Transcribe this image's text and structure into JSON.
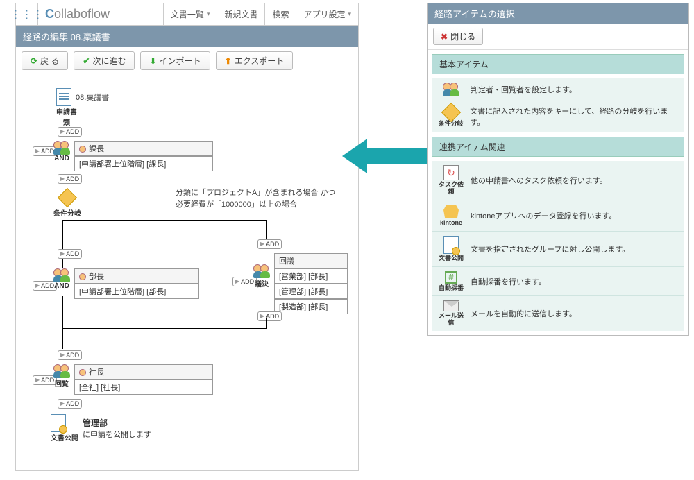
{
  "brand": {
    "pre": "C",
    "rest": "ollaboflow"
  },
  "topmenu": [
    {
      "label": "文書一覧",
      "chev": true
    },
    {
      "label": "新規文書",
      "chev": false
    },
    {
      "label": "検索",
      "chev": false
    },
    {
      "label": "アプリ設定",
      "chev": true
    }
  ],
  "titlebar": "経路の編集 08.稟議書",
  "toolbar": {
    "back": "戻 る",
    "next": "次に進む",
    "import": "インポート",
    "export": "エクスポート"
  },
  "add_label": "ADD",
  "flow": {
    "docnode": {
      "title": "08.稟議書",
      "label": "申請書類"
    },
    "n1": {
      "role": "課長",
      "detail": "[申請部署上位階層] [課長]",
      "badge": "AND"
    },
    "branch": {
      "label": "条件分岐"
    },
    "cond": {
      "l1": "分類に「プロジェクトA」が含まれる場合 かつ",
      "l2": "必要経費が「1000000」以上の場合"
    },
    "n2": {
      "role": "部長",
      "detail": "[申請部署上位階層] [部長]",
      "badge": "AND"
    },
    "n3": {
      "title": "回議",
      "r1": "[営業部] [部長]",
      "r2": "[管理部] [部長]",
      "r3": "[製造部] [部長]",
      "badge": "議決"
    },
    "n4": {
      "role": "社長",
      "detail": "[全社] [社長]",
      "badge": "回覧"
    },
    "n5": {
      "title": "管理部",
      "desc": "に申請を公開します",
      "badge": "文書公開"
    }
  },
  "popup": {
    "title": "経路アイテムの選択",
    "close": "閉じる",
    "sections": [
      {
        "head": "基本アイテム",
        "items": [
          {
            "icon": "people",
            "iclabel": "",
            "desc": "判定者・回覧者を設定します。"
          },
          {
            "icon": "diamond",
            "iclabel": "条件分岐",
            "desc": "文書に記入された内容をキーにして、経路の分岐を行います。"
          }
        ]
      },
      {
        "head": "連携アイテム関連",
        "items": [
          {
            "icon": "task",
            "iclabel": "タスク依頼",
            "desc": "他の申請書へのタスク依頼を行います。"
          },
          {
            "icon": "kintone",
            "iclabel": "kintone",
            "desc": "kintoneアプリへのデータ登録を行います。"
          },
          {
            "icon": "docpub",
            "iclabel": "文書公開",
            "desc": "文書を指定されたグループに対し公開します。"
          },
          {
            "icon": "hash",
            "iclabel": "自動採番",
            "desc": "自動採番を行います。"
          },
          {
            "icon": "mail",
            "iclabel": "メール送信",
            "desc": "メールを自動的に送信します。"
          }
        ]
      }
    ]
  }
}
